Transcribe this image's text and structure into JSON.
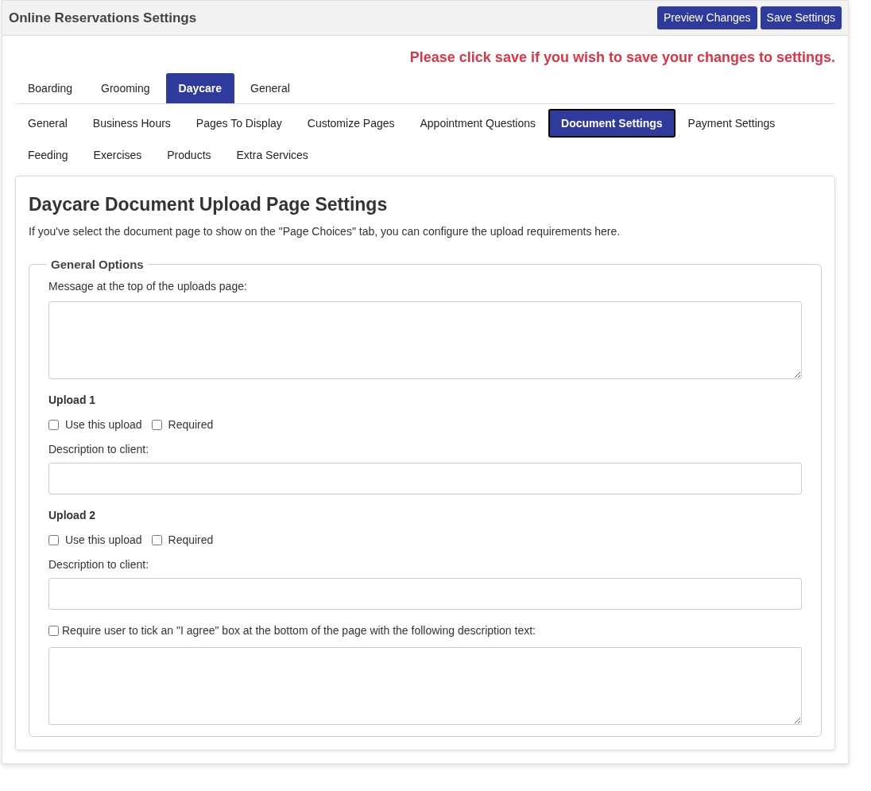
{
  "header": {
    "title": "Online Reservations Settings",
    "buttons": [
      "Preview Changes",
      "Save Settings"
    ]
  },
  "notice": "Please click save if you wish to save your changes to settings.",
  "service_tabs": [
    {
      "label": "Boarding",
      "selected": false
    },
    {
      "label": "Grooming",
      "selected": false
    },
    {
      "label": "Daycare",
      "selected": true
    },
    {
      "label": "General",
      "selected": false
    }
  ],
  "settings_tabs": [
    {
      "label": "General",
      "selected": false
    },
    {
      "label": "Business Hours",
      "selected": false
    },
    {
      "label": "Pages To Display",
      "selected": false
    },
    {
      "label": "Customize Pages",
      "selected": false
    },
    {
      "label": "Appointment Questions",
      "selected": false
    },
    {
      "label": "Document Settings",
      "selected": true
    },
    {
      "label": "Payment Settings",
      "selected": false
    },
    {
      "label": "Feeding",
      "selected": false
    },
    {
      "label": "Exercises",
      "selected": false
    },
    {
      "label": "Products",
      "selected": false
    },
    {
      "label": "Extra Services",
      "selected": false
    }
  ],
  "card": {
    "title": "Daycare Document Upload Page Settings",
    "description": "If you've select the document page to show on the \"Page Choices\" tab, you can configure the upload requirements here.",
    "fieldset": {
      "legend": "General Options",
      "message_label": "Message at the top of the uploads page:",
      "uploads": [
        {
          "title": "Upload 1",
          "options": [
            {
              "label": "Use this upload",
              "checked": false
            },
            {
              "label": "Required",
              "checked": false
            }
          ],
          "description_label": "Description to client:"
        },
        {
          "title": "Upload 2",
          "options": [
            {
              "label": "Use this upload",
              "checked": false
            },
            {
              "label": "Required",
              "checked": false
            }
          ],
          "description_label": "Description to client:"
        }
      ],
      "agree": {
        "label": "Require user to tick an \"I agree\" box at the bottom of the page with the following description text:",
        "checked": false
      }
    }
  }
}
